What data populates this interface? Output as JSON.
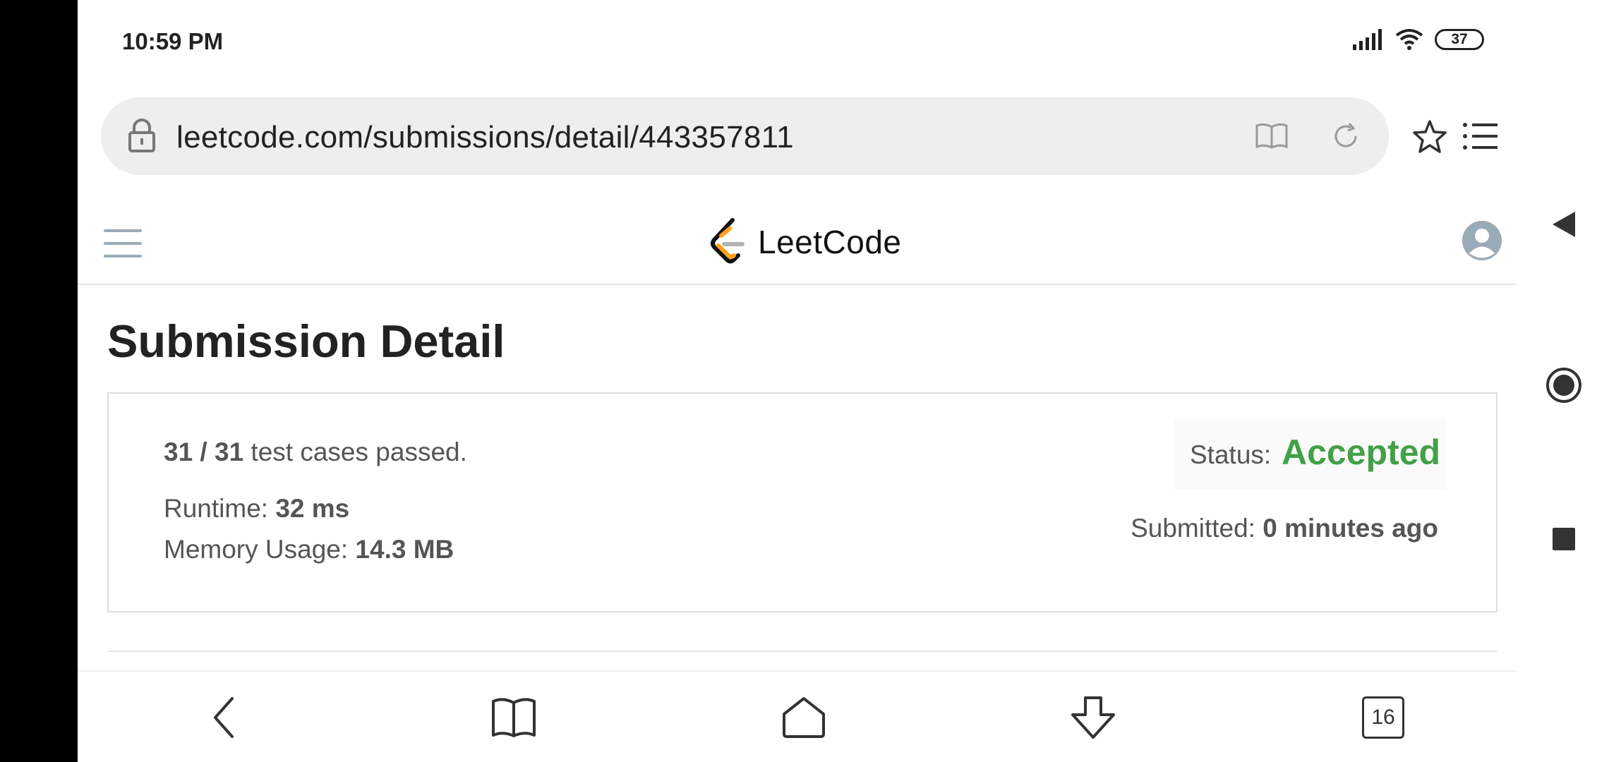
{
  "status_bar": {
    "time": "10:59 PM",
    "battery": "37",
    "icons": [
      "signal-icon",
      "wifi-icon",
      "battery-icon"
    ]
  },
  "browser": {
    "url": "leetcode.com/submissions/detail/443357811",
    "tab_count": "16"
  },
  "site": {
    "logo_text": "LeetCode"
  },
  "page": {
    "title": "Submission Detail",
    "passed_count": "31 / 31",
    "passed_suffix": " test cases passed.",
    "runtime_label": "Runtime: ",
    "runtime_value": "32 ms",
    "memory_label": "Memory Usage: ",
    "memory_value": "14.3 MB",
    "status_label": "Status: ",
    "status_value": "Accepted",
    "submitted_label": "Submitted: ",
    "submitted_value": "0 minutes ago"
  },
  "colors": {
    "accepted": "#43a047",
    "logo_orange": "#ffa116"
  }
}
